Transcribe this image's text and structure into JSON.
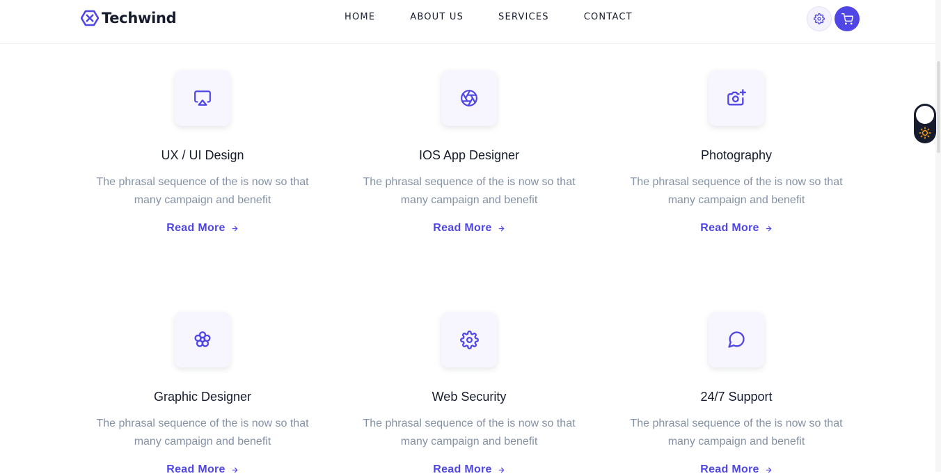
{
  "brand": {
    "name": "Techwind",
    "accent": "#4f46e5"
  },
  "nav": {
    "items": [
      {
        "label": "HOME"
      },
      {
        "label": "ABOUT US"
      },
      {
        "label": "SERVICES"
      },
      {
        "label": "CONTACT"
      }
    ]
  },
  "header": {
    "settings_icon": "gear-icon",
    "cart_icon": "cart-icon"
  },
  "theme_toggle": {
    "icon": "sun-icon",
    "mode": "light"
  },
  "services": [
    {
      "icon": "airplay-icon",
      "title": "UX / UI Design",
      "desc": "The phrasal sequence of the is now so that many campaign and benefit",
      "link": "Read More"
    },
    {
      "icon": "aperture-icon",
      "title": "IOS App Designer",
      "desc": "The phrasal sequence of the is now so that many campaign and benefit",
      "link": "Read More"
    },
    {
      "icon": "camera-plus-icon",
      "title": "Photography",
      "desc": "The phrasal sequence of the is now so that many campaign and benefit",
      "link": "Read More"
    },
    {
      "icon": "flower-icon",
      "title": "Graphic Designer",
      "desc": "The phrasal sequence of the is now so that many campaign and benefit",
      "link": "Read More"
    },
    {
      "icon": "gear-icon",
      "title": "Web Security",
      "desc": "The phrasal sequence of the is now so that many campaign and benefit",
      "link": "Read More"
    },
    {
      "icon": "message-circle-icon",
      "title": "24/7 Support",
      "desc": "The phrasal sequence of the is now so that many campaign and benefit",
      "link": "Read More"
    }
  ]
}
